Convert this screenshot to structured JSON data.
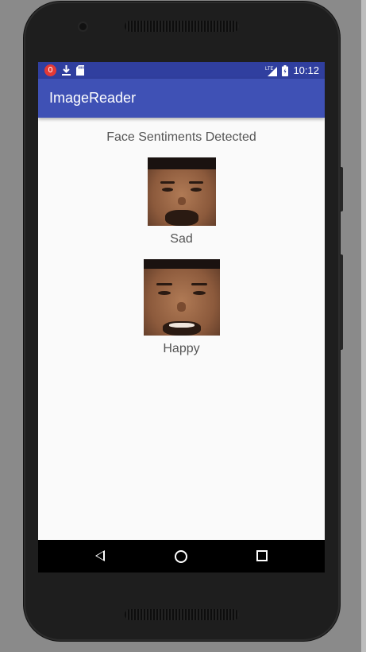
{
  "status_bar": {
    "time": "10:12",
    "network_label": "LTE",
    "icons": [
      "mic-notification-icon",
      "download-icon",
      "sd-card-icon",
      "lte-signal-icon",
      "battery-icon"
    ]
  },
  "app_bar": {
    "title": "ImageReader"
  },
  "content": {
    "heading": "Face Sentiments Detected",
    "faces": [
      {
        "sentiment": "Sad"
      },
      {
        "sentiment": "Happy"
      }
    ]
  },
  "nav_bar": {
    "buttons": [
      "back-icon",
      "home-icon",
      "recents-icon"
    ]
  },
  "colors": {
    "status_bar": "#303f9f",
    "app_bar": "#3f51b5",
    "screen_bg": "#fafafa",
    "text": "#555555"
  }
}
